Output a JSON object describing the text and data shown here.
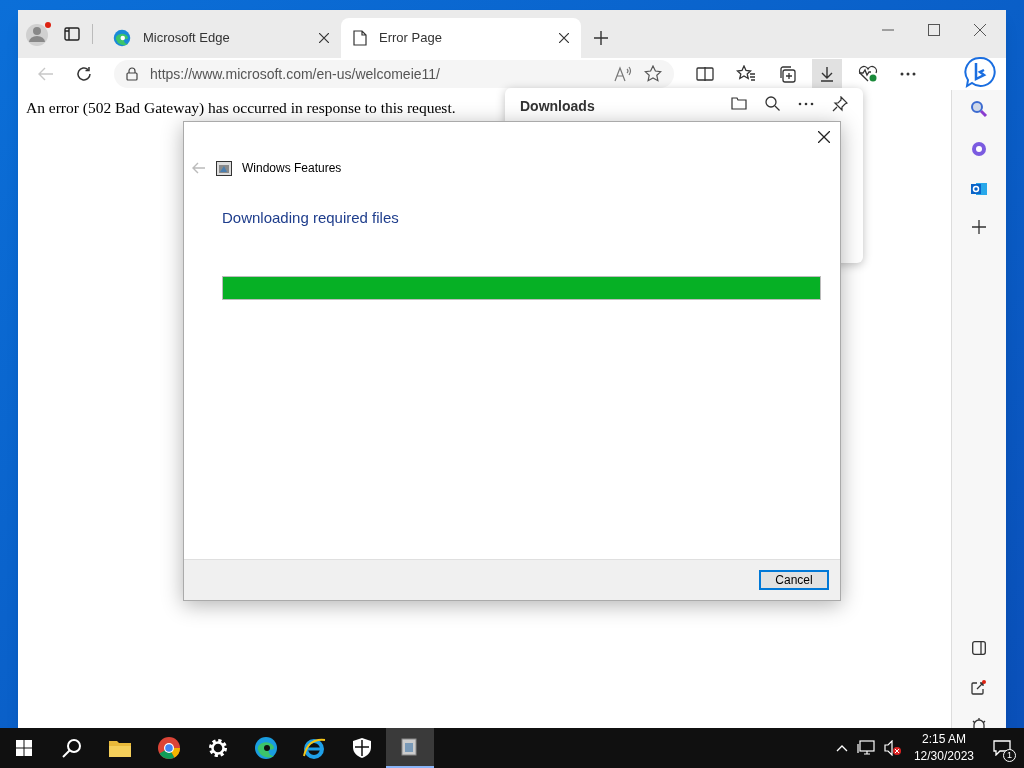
{
  "browser": {
    "tabs": [
      {
        "label": "Microsoft Edge",
        "selected": false,
        "kind": "edge"
      },
      {
        "label": "Error Page",
        "selected": true,
        "kind": "page"
      }
    ],
    "address": "https://www.microsoft.com/en-us/welcomeie11/",
    "page_text": "An error (502 Bad Gateway) has occurred in response to this request.",
    "downloads_panel": {
      "title": "Downloads"
    }
  },
  "dialog": {
    "title": "Windows Features",
    "heading": "Downloading required files",
    "progress": {
      "level": 1
    },
    "cancel_button": "Cancel"
  },
  "taskbar": {
    "time": "2:15 AM",
    "date": "12/30/2023",
    "notification_count": "1"
  }
}
